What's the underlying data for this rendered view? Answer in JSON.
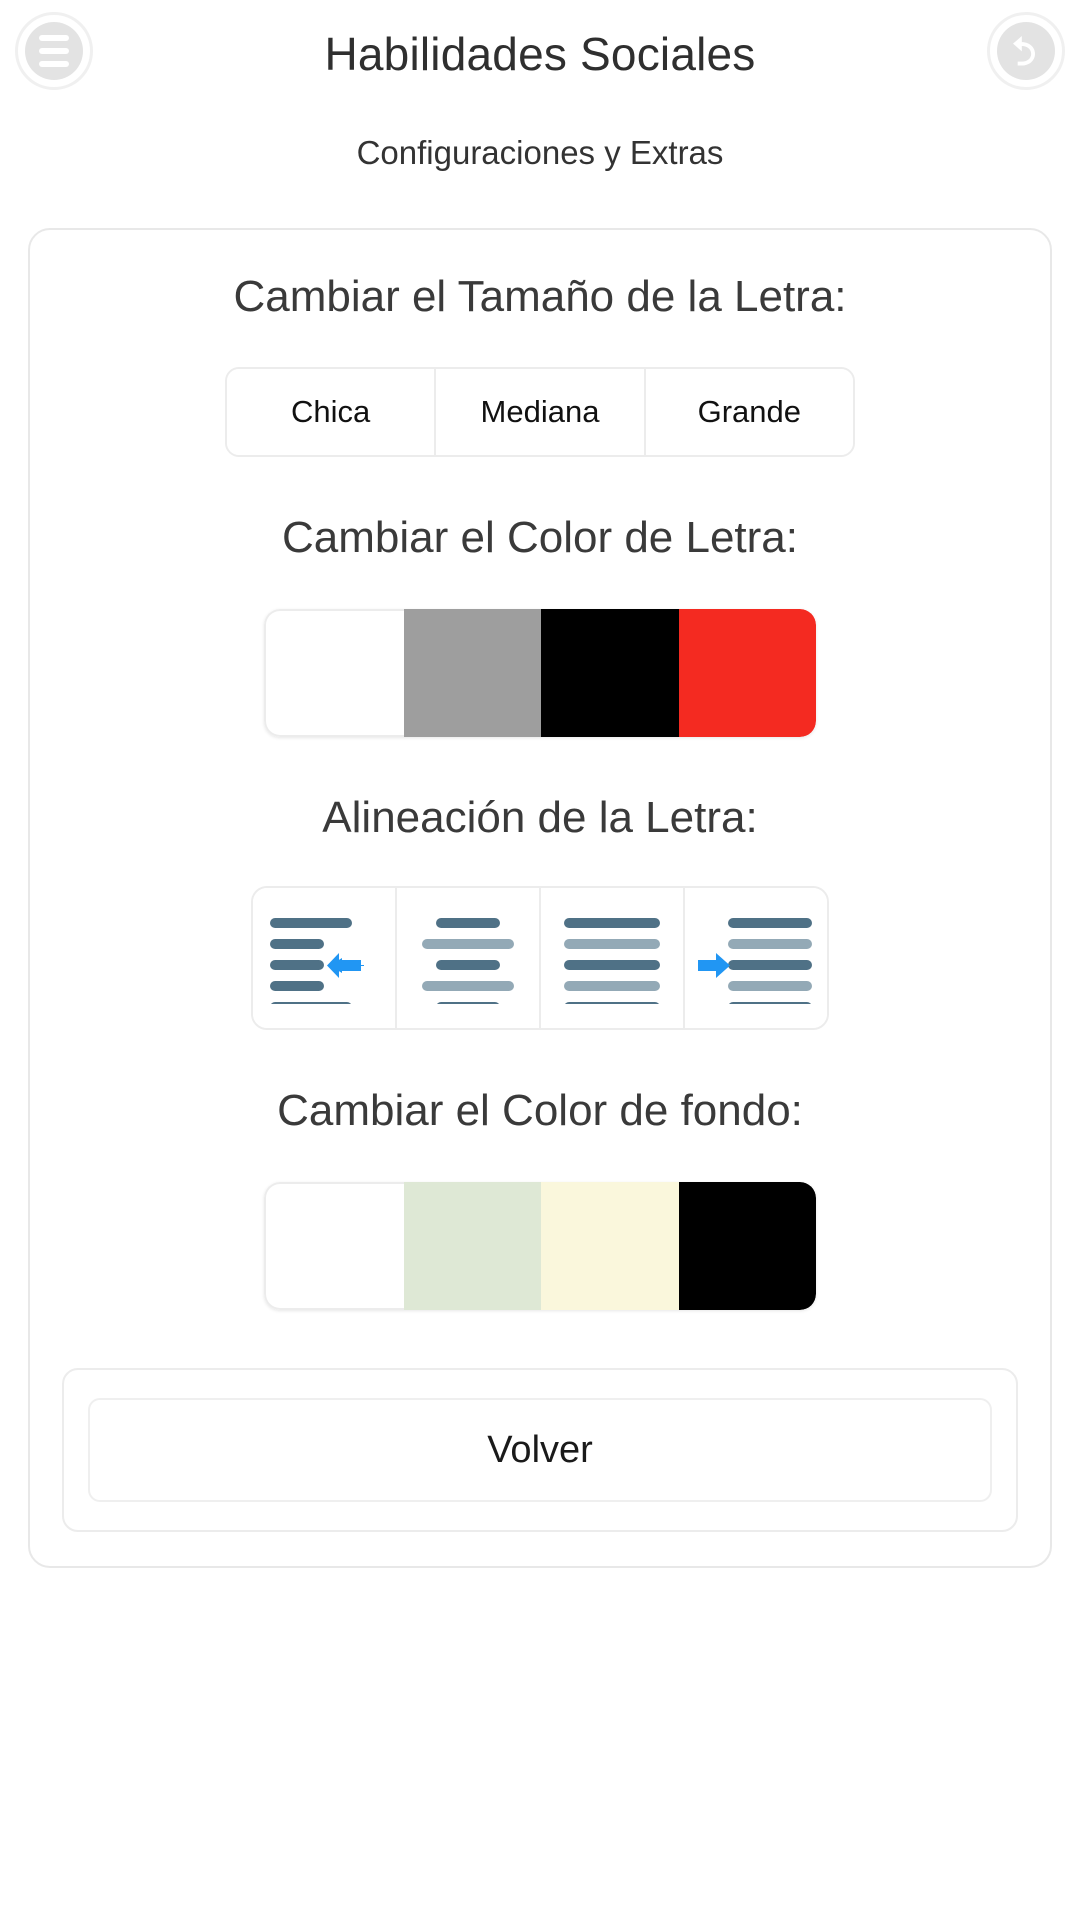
{
  "header": {
    "title": "Habilidades Sociales",
    "subtitle": "Configuraciones y Extras",
    "menu_icon": "hamburger-menu-icon",
    "back_icon": "undo-back-arrow-icon"
  },
  "sections": {
    "font_size": {
      "title": "Cambiar el Tamaño de la Letra:",
      "options": [
        {
          "label": "Chica"
        },
        {
          "label": "Mediana"
        },
        {
          "label": "Grande"
        }
      ]
    },
    "text_color": {
      "title": "Cambiar el Color de Letra:",
      "swatches": [
        {
          "name": "white",
          "color": "#ffffff"
        },
        {
          "name": "gray",
          "color": "#9e9e9e"
        },
        {
          "name": "black",
          "color": "#000000"
        },
        {
          "name": "red",
          "color": "#f42a21"
        }
      ]
    },
    "alignment": {
      "title": "Alineación de la Letra:",
      "options": [
        {
          "name": "align-left-icon"
        },
        {
          "name": "align-center-icon"
        },
        {
          "name": "align-justify-icon"
        },
        {
          "name": "align-right-indent-icon"
        }
      ],
      "bar_dark": "#4f7186",
      "bar_light": "#93a9b6",
      "arrow_color": "#2196f3"
    },
    "background_color": {
      "title": "Cambiar el Color de fondo:",
      "swatches": [
        {
          "name": "white",
          "color": "#ffffff"
        },
        {
          "name": "pale-green",
          "color": "#dee8d5"
        },
        {
          "name": "pale-yellow",
          "color": "#faf7dc"
        },
        {
          "name": "black",
          "color": "#000000"
        }
      ]
    }
  },
  "footer": {
    "back_label": "Volver"
  }
}
